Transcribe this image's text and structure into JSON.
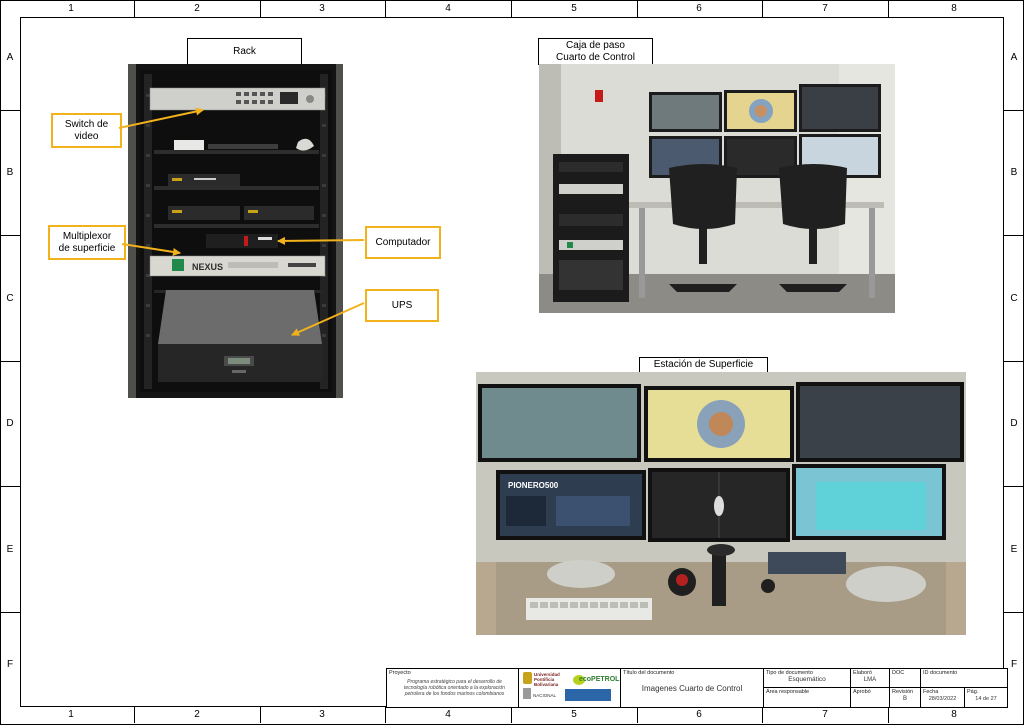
{
  "border": {
    "columns": [
      "1",
      "2",
      "3",
      "4",
      "5",
      "6",
      "7",
      "8"
    ],
    "rows": [
      "A",
      "B",
      "C",
      "D",
      "E",
      "F"
    ]
  },
  "captions": {
    "rack": "Rack",
    "caja_line1": "Caja de paso",
    "caja_line2": "Cuarto de Control",
    "estacion": "Estación de Superficie"
  },
  "callouts": {
    "switch_line1": "Switch de",
    "switch_line2": "video",
    "mux_line1": "Multiplexor",
    "mux_line2": "de superficie",
    "computador": "Computador",
    "ups": "UPS"
  },
  "equipment_labels": {
    "nexus": "NEXUS",
    "pionero": "PIONERO500"
  },
  "title_block": {
    "proyecto_label": "Proyecto",
    "proyecto_text": "Programa estratégico para el desarrollo de tecnología robótica orientado a la exploración petrolera de los fondos marinos colombianos",
    "logo_upb": "Universidad Pontificia Bolivariana",
    "logo_ecopetrol": "ecoPETROL",
    "logo_nacional": "NACIONAL",
    "titulo_label": "Título del documento",
    "titulo": "Imagenes Cuarto de Control",
    "tipo_label": "Tipo de documento",
    "tipo_value": "Esquemático",
    "area_label": "Área responsable",
    "elaboro_label": "Elaboró",
    "elaboro_value": "LMA",
    "aprobo_label": "Aprobó",
    "doc_label": "DOC",
    "id_label": "ID documento",
    "revision_label": "Revisión",
    "revision_value": "B",
    "fecha_label": "Fecha",
    "fecha_value": "28/03/2022",
    "pag_label": "Pág.",
    "pag_value": "14 de 27"
  },
  "colors": {
    "callout_border": "#f2b21c",
    "rack_black": "#1b1b1b",
    "wall": "#dadad4"
  }
}
